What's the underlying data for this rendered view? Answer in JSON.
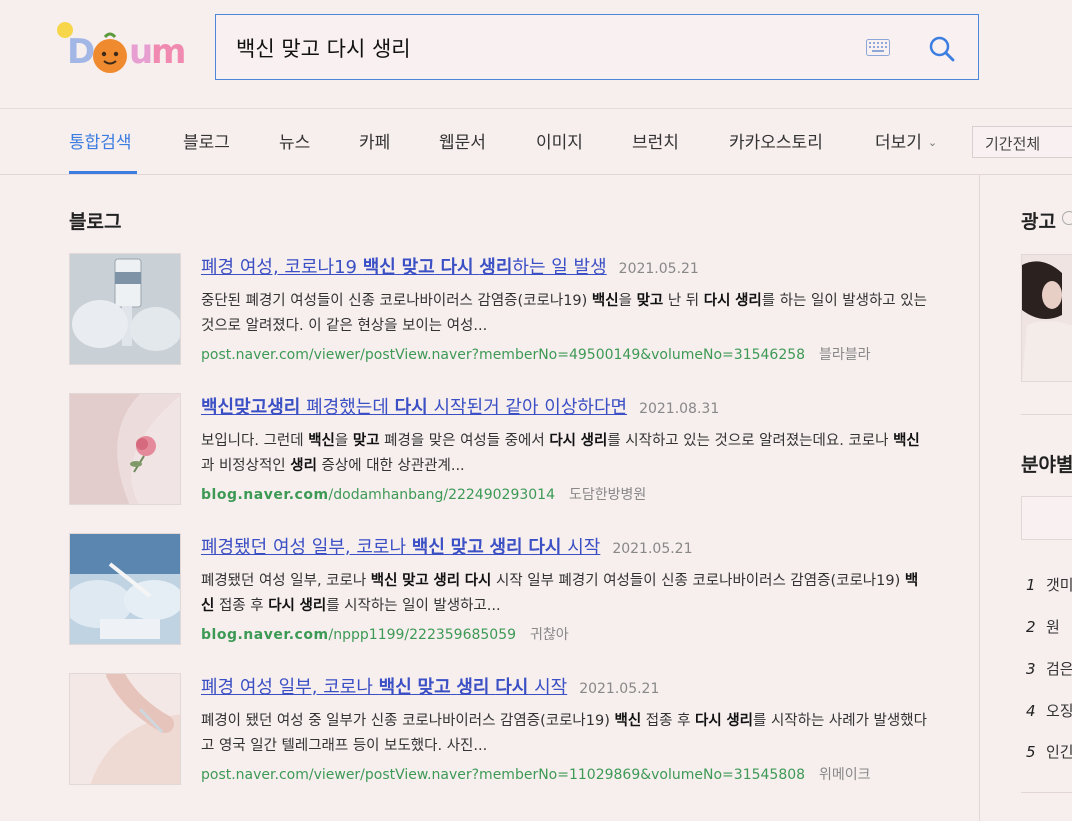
{
  "logo_text": "Daum",
  "search": {
    "query": "백신 맞고 다시 생리"
  },
  "tabs": [
    {
      "label": "통합검색",
      "active": true
    },
    {
      "label": "블로그"
    },
    {
      "label": "뉴스"
    },
    {
      "label": "카페"
    },
    {
      "label": "웹문서"
    },
    {
      "label": "이미지"
    },
    {
      "label": "브런치"
    },
    {
      "label": "카카오스토리"
    },
    {
      "label": "더보기"
    }
  ],
  "period_select": "기간전체",
  "section_title": "블로그",
  "results": [
    {
      "title_html": "폐경 여성, 코로나19 <b>백신</b> <b>맞고</b> <b>다시</b> <b>생리</b>하는 일 발생",
      "date": "2021.05.21",
      "desc_html": "중단된 폐경기 여성들이 신종 코로나바이러스 감염증(코로나19) <b>백신</b>을 <b>맞고</b> 난 뒤 <b>다시</b> <b>생리</b>를 하는 일이 발생하고 있는 것으로 알려졌다. 이 같은 현상을 보이는 여성...",
      "url_host": "post.naver.com",
      "url_path": "/viewer/postView.naver?memberNo=49500149&volumeNo=31546258",
      "author": "블라블라"
    },
    {
      "title_html": "<b>백신맞고생리</b> 폐경했는데 <b>다시</b> 시작된거 같아 이상하다면",
      "date": "2021.08.31",
      "desc_html": "보입니다.  그런데 <b>백신</b>을 <b>맞고</b> 폐경을 맞은 여성들 중에서 <b>다시</b> <b>생리</b>를 시작하고 있는 것으로 알려졌는데요.     코로나 <b>백신</b>과 비정상적인 <b>생리</b> 증상에 대한 상관관계...",
      "url_host": "blog.naver.com",
      "url_path": "/dodamhanbang/222490293014",
      "author": "도담한방병원"
    },
    {
      "title_html": "폐경됐던 여성 일부, 코로나 <b>백신</b> <b>맞고</b> <b>생리</b> <b>다시</b> 시작",
      "date": "2021.05.21",
      "desc_html": "폐경됐던 여성 일부, 코로나 <b>백신</b> <b>맞고</b> <b>생리</b> <b>다시</b> 시작 일부 폐경기 여성들이 신종 코로나바이러스 감염증(코로나19) <b>백신</b> 접종 후 <b>다시</b> <b>생리</b>를 시작하는 일이 발생하고...",
      "url_host": "blog.naver.com",
      "url_path": "/nppp1199/222359685059",
      "author": "귀찮아"
    },
    {
      "title_html": "폐경 여성 일부, 코로나 <b>백신</b> <b>맞고</b> <b>생리</b> <b>다시</b> 시작",
      "date": "2021.05.21",
      "desc_html": "폐경이 됐던 여성 중 일부가 신종 코로나바이러스 감염증(코로나19) <b>백신</b> 접종 후 <b>다시</b> <b>생리</b>를 시작하는 사례가 발생했다고 영국 일간 텔레그래프 등이 보도했다. 사진...",
      "url_host": "post.naver.com",
      "url_path": "/viewer/postView.naver?memberNo=11029869&volumeNo=31545808",
      "author": "위메이크"
    }
  ],
  "right": {
    "ad_title": "광고",
    "field_title": "분야별",
    "rankings": [
      {
        "num": "1",
        "text": "갯미"
      },
      {
        "num": "2",
        "text": "원"
      },
      {
        "num": "3",
        "text": "검은"
      },
      {
        "num": "4",
        "text": "오징"
      },
      {
        "num": "5",
        "text": "인긴"
      }
    ]
  },
  "colors": {
    "accent": "#3b7de0",
    "link": "#3b50c4",
    "url": "#3d9a55",
    "background": "#f7eeee"
  }
}
